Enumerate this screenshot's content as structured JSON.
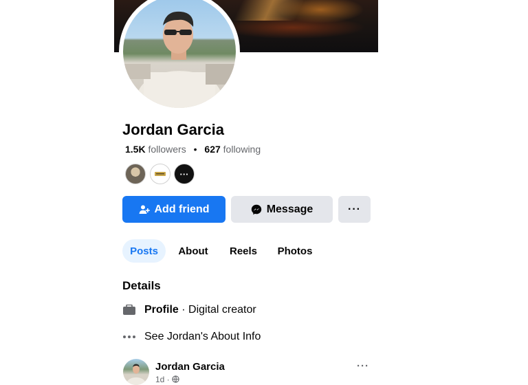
{
  "profile": {
    "name": "Jordan Garcia",
    "followers_count": "1.5K",
    "followers_label": "followers",
    "separator": "•",
    "following_count": "627",
    "following_label": "following"
  },
  "mutual": {
    "more_label": "···"
  },
  "actions": {
    "add_friend_label": "Add friend",
    "message_label": "Message",
    "more_label": "···"
  },
  "tabs": [
    {
      "label": "Posts",
      "active": true
    },
    {
      "label": "About",
      "active": false
    },
    {
      "label": "Reels",
      "active": false
    },
    {
      "label": "Photos",
      "active": false
    }
  ],
  "details": {
    "title": "Details",
    "profile_type_label": "Profile",
    "profile_type_value": " · Digital creator",
    "about_link": "See Jordan's About Info"
  },
  "post": {
    "author": "Jordan Garcia",
    "time": "1d ·",
    "more_label": "···"
  },
  "colors": {
    "accent": "#1877f2",
    "button_secondary": "#e4e6eb",
    "tab_active_bg": "#e7f3ff",
    "muted_text": "#65676b"
  },
  "icons": {
    "add_friend": "person-plus-icon",
    "message": "messenger-icon",
    "profile": "briefcase-icon",
    "about": "more-dots-icon",
    "privacy": "globe-icon"
  }
}
